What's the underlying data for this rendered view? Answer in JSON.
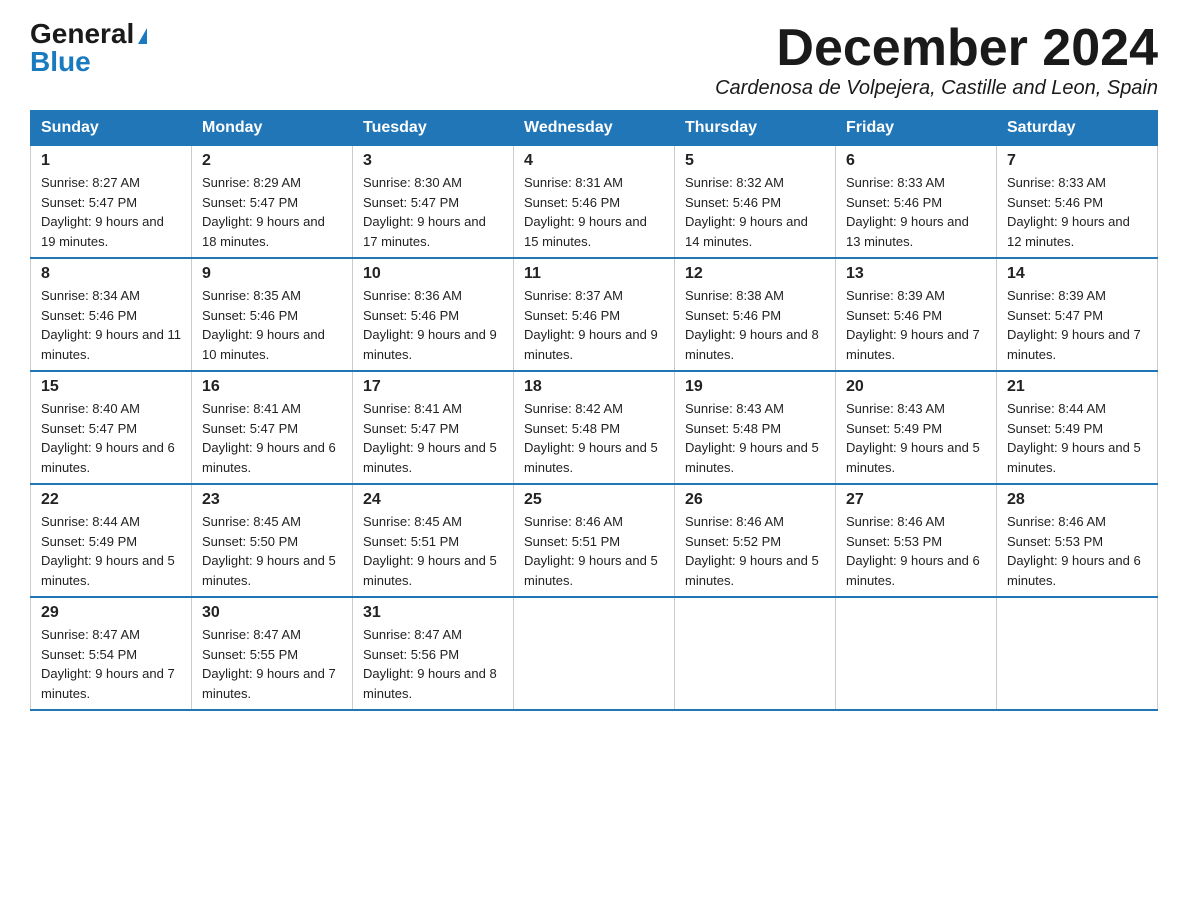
{
  "logo": {
    "general": "General",
    "blue": "Blue",
    "triangle": "▶"
  },
  "title": "December 2024",
  "subtitle": "Cardenosa de Volpejera, Castille and Leon, Spain",
  "days_of_week": [
    "Sunday",
    "Monday",
    "Tuesday",
    "Wednesday",
    "Thursday",
    "Friday",
    "Saturday"
  ],
  "weeks": [
    [
      {
        "day": "1",
        "sunrise": "8:27 AM",
        "sunset": "5:47 PM",
        "daylight": "9 hours and 19 minutes."
      },
      {
        "day": "2",
        "sunrise": "8:29 AM",
        "sunset": "5:47 PM",
        "daylight": "9 hours and 18 minutes."
      },
      {
        "day": "3",
        "sunrise": "8:30 AM",
        "sunset": "5:47 PM",
        "daylight": "9 hours and 17 minutes."
      },
      {
        "day": "4",
        "sunrise": "8:31 AM",
        "sunset": "5:46 PM",
        "daylight": "9 hours and 15 minutes."
      },
      {
        "day": "5",
        "sunrise": "8:32 AM",
        "sunset": "5:46 PM",
        "daylight": "9 hours and 14 minutes."
      },
      {
        "day": "6",
        "sunrise": "8:33 AM",
        "sunset": "5:46 PM",
        "daylight": "9 hours and 13 minutes."
      },
      {
        "day": "7",
        "sunrise": "8:33 AM",
        "sunset": "5:46 PM",
        "daylight": "9 hours and 12 minutes."
      }
    ],
    [
      {
        "day": "8",
        "sunrise": "8:34 AM",
        "sunset": "5:46 PM",
        "daylight": "9 hours and 11 minutes."
      },
      {
        "day": "9",
        "sunrise": "8:35 AM",
        "sunset": "5:46 PM",
        "daylight": "9 hours and 10 minutes."
      },
      {
        "day": "10",
        "sunrise": "8:36 AM",
        "sunset": "5:46 PM",
        "daylight": "9 hours and 9 minutes."
      },
      {
        "day": "11",
        "sunrise": "8:37 AM",
        "sunset": "5:46 PM",
        "daylight": "9 hours and 9 minutes."
      },
      {
        "day": "12",
        "sunrise": "8:38 AM",
        "sunset": "5:46 PM",
        "daylight": "9 hours and 8 minutes."
      },
      {
        "day": "13",
        "sunrise": "8:39 AM",
        "sunset": "5:46 PM",
        "daylight": "9 hours and 7 minutes."
      },
      {
        "day": "14",
        "sunrise": "8:39 AM",
        "sunset": "5:47 PM",
        "daylight": "9 hours and 7 minutes."
      }
    ],
    [
      {
        "day": "15",
        "sunrise": "8:40 AM",
        "sunset": "5:47 PM",
        "daylight": "9 hours and 6 minutes."
      },
      {
        "day": "16",
        "sunrise": "8:41 AM",
        "sunset": "5:47 PM",
        "daylight": "9 hours and 6 minutes."
      },
      {
        "day": "17",
        "sunrise": "8:41 AM",
        "sunset": "5:47 PM",
        "daylight": "9 hours and 5 minutes."
      },
      {
        "day": "18",
        "sunrise": "8:42 AM",
        "sunset": "5:48 PM",
        "daylight": "9 hours and 5 minutes."
      },
      {
        "day": "19",
        "sunrise": "8:43 AM",
        "sunset": "5:48 PM",
        "daylight": "9 hours and 5 minutes."
      },
      {
        "day": "20",
        "sunrise": "8:43 AM",
        "sunset": "5:49 PM",
        "daylight": "9 hours and 5 minutes."
      },
      {
        "day": "21",
        "sunrise": "8:44 AM",
        "sunset": "5:49 PM",
        "daylight": "9 hours and 5 minutes."
      }
    ],
    [
      {
        "day": "22",
        "sunrise": "8:44 AM",
        "sunset": "5:49 PM",
        "daylight": "9 hours and 5 minutes."
      },
      {
        "day": "23",
        "sunrise": "8:45 AM",
        "sunset": "5:50 PM",
        "daylight": "9 hours and 5 minutes."
      },
      {
        "day": "24",
        "sunrise": "8:45 AM",
        "sunset": "5:51 PM",
        "daylight": "9 hours and 5 minutes."
      },
      {
        "day": "25",
        "sunrise": "8:46 AM",
        "sunset": "5:51 PM",
        "daylight": "9 hours and 5 minutes."
      },
      {
        "day": "26",
        "sunrise": "8:46 AM",
        "sunset": "5:52 PM",
        "daylight": "9 hours and 5 minutes."
      },
      {
        "day": "27",
        "sunrise": "8:46 AM",
        "sunset": "5:53 PM",
        "daylight": "9 hours and 6 minutes."
      },
      {
        "day": "28",
        "sunrise": "8:46 AM",
        "sunset": "5:53 PM",
        "daylight": "9 hours and 6 minutes."
      }
    ],
    [
      {
        "day": "29",
        "sunrise": "8:47 AM",
        "sunset": "5:54 PM",
        "daylight": "9 hours and 7 minutes."
      },
      {
        "day": "30",
        "sunrise": "8:47 AM",
        "sunset": "5:55 PM",
        "daylight": "9 hours and 7 minutes."
      },
      {
        "day": "31",
        "sunrise": "8:47 AM",
        "sunset": "5:56 PM",
        "daylight": "9 hours and 8 minutes."
      },
      null,
      null,
      null,
      null
    ]
  ]
}
